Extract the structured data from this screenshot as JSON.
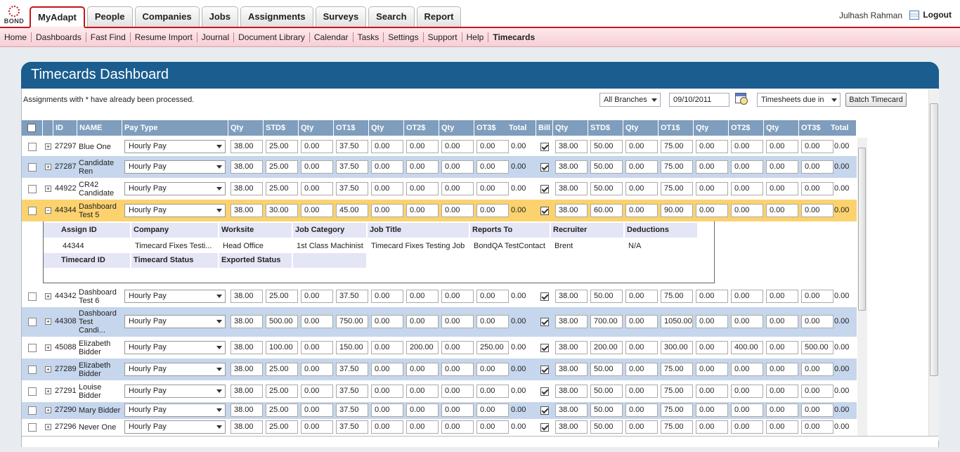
{
  "header": {
    "logo_text": "BOND",
    "tabs": [
      "MyAdapt",
      "People",
      "Companies",
      "Jobs",
      "Assignments",
      "Surveys",
      "Search",
      "Report"
    ],
    "active_tab": 0,
    "user_name": "Julhash Rahman",
    "logout_label": "Logout"
  },
  "subnav": {
    "items": [
      "Home",
      "Dashboards",
      "Fast Find",
      "Resume Import",
      "Journal",
      "Document Library",
      "Calendar",
      "Tasks",
      "Settings",
      "Support",
      "Help",
      "Timecards"
    ],
    "active": 11
  },
  "panel": {
    "title": "Timecards Dashboard",
    "note": "Assignments with * have already been processed.",
    "branch_select": "All Branches",
    "date_value": "09/10/2011",
    "timesheet_select": "Timesheets due in",
    "batch_button": "Batch Timecard"
  },
  "columns": [
    "ID",
    "NAME",
    "Pay Type",
    "Qty",
    "STD$",
    "Qty",
    "OT1$",
    "Qty",
    "OT2$",
    "Qty",
    "OT3$",
    "Total",
    "Bill",
    "Qty",
    "STD$",
    "Qty",
    "OT1$",
    "Qty",
    "OT2$",
    "Qty",
    "OT3$",
    "Total"
  ],
  "rows": [
    {
      "id": "27297",
      "name": [
        "Blue One"
      ],
      "pay": "Hourly Pay",
      "p": [
        "38.00",
        "25.00",
        "0.00",
        "37.50",
        "0.00",
        "0.00",
        "0.00",
        "0.00"
      ],
      "ptotal": "0.00",
      "bill_checked": true,
      "b": [
        "38.00",
        "50.00",
        "0.00",
        "75.00",
        "0.00",
        "0.00",
        "0.00",
        "0.00"
      ],
      "btotal": "0.00",
      "expand": "+"
    },
    {
      "id": "27287",
      "name": [
        "Candidate",
        "Ren"
      ],
      "pay": "Hourly Pay",
      "p": [
        "38.00",
        "25.00",
        "0.00",
        "37.50",
        "0.00",
        "0.00",
        "0.00",
        "0.00"
      ],
      "ptotal": "0.00",
      "bill_checked": true,
      "b": [
        "38.00",
        "50.00",
        "0.00",
        "75.00",
        "0.00",
        "0.00",
        "0.00",
        "0.00"
      ],
      "btotal": "0.00",
      "expand": "+"
    },
    {
      "id": "44922",
      "name": [
        "CR42",
        "Candidate"
      ],
      "pay": "Hourly Pay",
      "p": [
        "38.00",
        "25.00",
        "0.00",
        "37.50",
        "0.00",
        "0.00",
        "0.00",
        "0.00"
      ],
      "ptotal": "0.00",
      "bill_checked": true,
      "b": [
        "38.00",
        "50.00",
        "0.00",
        "75.00",
        "0.00",
        "0.00",
        "0.00",
        "0.00"
      ],
      "btotal": "0.00",
      "expand": "+"
    },
    {
      "id": "44344",
      "name": [
        "Dashboard",
        "Test 5"
      ],
      "pay": "Hourly Pay",
      "p": [
        "38.00",
        "30.00",
        "0.00",
        "45.00",
        "0.00",
        "0.00",
        "0.00",
        "0.00"
      ],
      "ptotal": "0.00",
      "bill_checked": true,
      "b": [
        "38.00",
        "60.00",
        "0.00",
        "90.00",
        "0.00",
        "0.00",
        "0.00",
        "0.00"
      ],
      "btotal": "0.00",
      "expand": "−"
    },
    {
      "id": "44342",
      "name": [
        "Dashboard",
        "Test 6"
      ],
      "pay": "Hourly Pay",
      "p": [
        "38.00",
        "25.00",
        "0.00",
        "37.50",
        "0.00",
        "0.00",
        "0.00",
        "0.00"
      ],
      "ptotal": "0.00",
      "bill_checked": true,
      "b": [
        "38.00",
        "50.00",
        "0.00",
        "75.00",
        "0.00",
        "0.00",
        "0.00",
        "0.00"
      ],
      "btotal": "0.00",
      "expand": "+"
    },
    {
      "id": "44308",
      "name": [
        "Dashboard",
        "Test",
        "Candi..."
      ],
      "pay": "Hourly Pay",
      "p": [
        "38.00",
        "500.00",
        "0.00",
        "750.00",
        "0.00",
        "0.00",
        "0.00",
        "0.00"
      ],
      "ptotal": "0.00",
      "bill_checked": true,
      "b": [
        "38.00",
        "700.00",
        "0.00",
        "1050.00",
        "0.00",
        "0.00",
        "0.00",
        "0.00"
      ],
      "btotal": "0.00",
      "expand": "+"
    },
    {
      "id": "45088",
      "name": [
        "Elizabeth",
        "Bidder"
      ],
      "pay": "Hourly Pay",
      "p": [
        "38.00",
        "100.00",
        "0.00",
        "150.00",
        "0.00",
        "200.00",
        "0.00",
        "250.00"
      ],
      "ptotal": "0.00",
      "bill_checked": true,
      "b": [
        "38.00",
        "200.00",
        "0.00",
        "300.00",
        "0.00",
        "400.00",
        "0.00",
        "500.00"
      ],
      "btotal": "0.00",
      "expand": "+"
    },
    {
      "id": "27289",
      "name": [
        "Elizabeth",
        "Bidder"
      ],
      "pay": "Hourly Pay",
      "p": [
        "38.00",
        "25.00",
        "0.00",
        "37.50",
        "0.00",
        "0.00",
        "0.00",
        "0.00"
      ],
      "ptotal": "0.00",
      "bill_checked": true,
      "b": [
        "38.00",
        "50.00",
        "0.00",
        "75.00",
        "0.00",
        "0.00",
        "0.00",
        "0.00"
      ],
      "btotal": "0.00",
      "expand": "+"
    },
    {
      "id": "27291",
      "name": [
        "Louise",
        "Bidder"
      ],
      "pay": "Hourly Pay",
      "p": [
        "38.00",
        "25.00",
        "0.00",
        "37.50",
        "0.00",
        "0.00",
        "0.00",
        "0.00"
      ],
      "ptotal": "0.00",
      "bill_checked": true,
      "b": [
        "38.00",
        "50.00",
        "0.00",
        "75.00",
        "0.00",
        "0.00",
        "0.00",
        "0.00"
      ],
      "btotal": "0.00",
      "expand": "+"
    },
    {
      "id": "27290",
      "name": [
        "Mary Bidder"
      ],
      "pay": "Hourly Pay",
      "p": [
        "38.00",
        "25.00",
        "0.00",
        "37.50",
        "0.00",
        "0.00",
        "0.00",
        "0.00"
      ],
      "ptotal": "0.00",
      "bill_checked": true,
      "b": [
        "38.00",
        "50.00",
        "0.00",
        "75.00",
        "0.00",
        "0.00",
        "0.00",
        "0.00"
      ],
      "btotal": "0.00",
      "expand": "+"
    },
    {
      "id": "27296",
      "name": [
        "Never One"
      ],
      "pay": "Hourly Pay",
      "p": [
        "38.00",
        "25.00",
        "0.00",
        "37.50",
        "0.00",
        "0.00",
        "0.00",
        "0.00"
      ],
      "ptotal": "0.00",
      "bill_checked": true,
      "b": [
        "38.00",
        "50.00",
        "0.00",
        "75.00",
        "0.00",
        "0.00",
        "0.00",
        "0.00"
      ],
      "btotal": "0.00",
      "expand": "+"
    }
  ],
  "detail": {
    "headers": [
      "Assign ID",
      "Company",
      "Worksite",
      "Job Category",
      "Job Title",
      "Reports To",
      "Recruiter",
      "Deductions"
    ],
    "values": [
      "44344",
      "Timecard Fixes Testi...",
      "Head Office",
      "1st Class Machinist",
      "Timecard Fixes Testing Job",
      "BondQA TestContact",
      "Brent",
      "N/A"
    ],
    "headers2": [
      "Timecard ID",
      "Timecard Status",
      "Exported Status"
    ]
  },
  "colors": {
    "brand_red": "#c4161c",
    "header_blue": "#1a5d8e",
    "grid_header": "#7f9dbd",
    "row_alt": "#c6d6ec",
    "row_selected": "#fbd26e"
  }
}
